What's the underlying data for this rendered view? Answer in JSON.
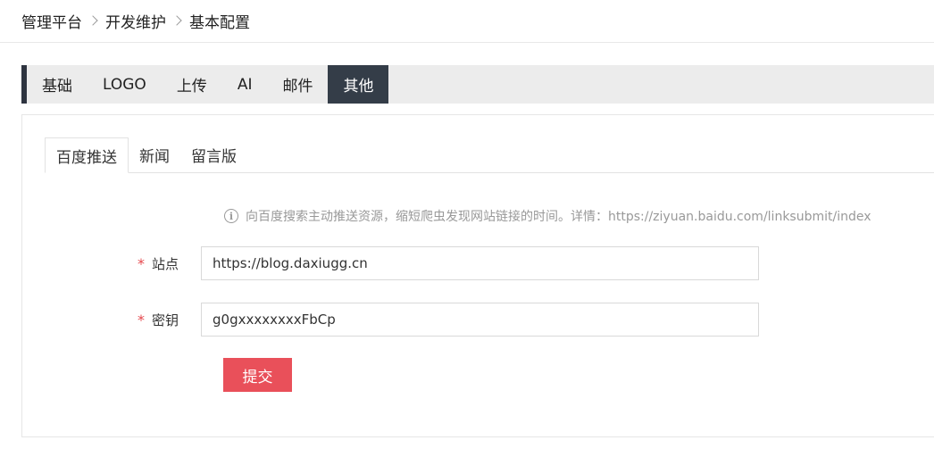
{
  "breadcrumb": [
    "管理平台",
    "开发维护",
    "基本配置"
  ],
  "main_tabs": [
    {
      "label": "基础"
    },
    {
      "label": "LOGO"
    },
    {
      "label": "上传"
    },
    {
      "label": "AI"
    },
    {
      "label": "邮件"
    },
    {
      "label": "其他",
      "active": true
    }
  ],
  "sub_tabs": [
    {
      "label": "百度推送",
      "active": true
    },
    {
      "label": "新闻"
    },
    {
      "label": "留言版"
    }
  ],
  "tip": {
    "icon": "info-icon",
    "text": "向百度搜索主动推送资源，缩短爬虫发现网站链接的时间。详情：https://ziyuan.baidu.com/linksubmit/index"
  },
  "form": {
    "site": {
      "required_mark": "*",
      "label": "站点",
      "value": "https://blog.daxiugg.cn"
    },
    "key": {
      "required_mark": "*",
      "label": "密钥",
      "value": "g0gxxxxxxxxFbCp"
    },
    "submit_label": "提交"
  },
  "colors": {
    "accent_dark": "#343d48",
    "submit": "#e9505a",
    "required": "#e5484d"
  }
}
